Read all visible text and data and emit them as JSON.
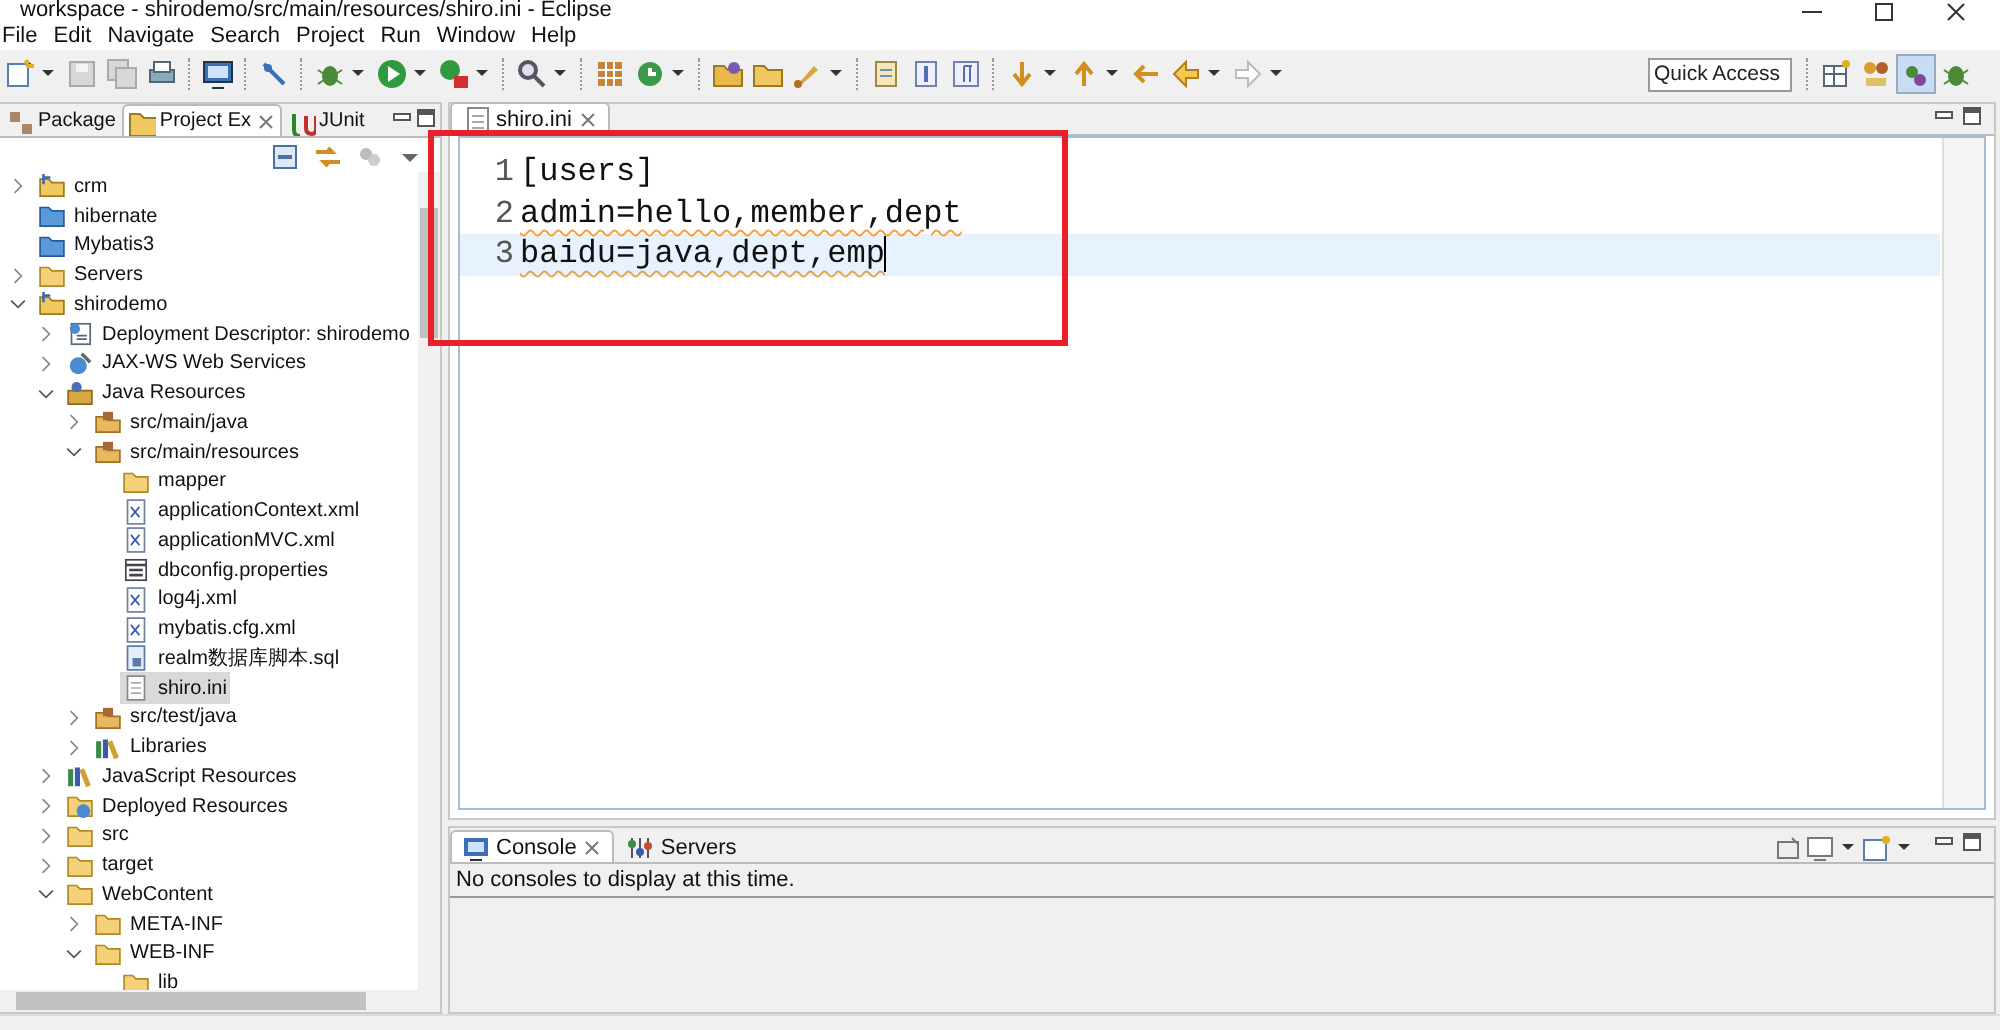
{
  "window": {
    "title": "workspace - shirodemo/src/main/resources/shiro.ini - Eclipse"
  },
  "menu": [
    "File",
    "Edit",
    "Navigate",
    "Search",
    "Project",
    "Run",
    "Window",
    "Help"
  ],
  "quick_access": {
    "placeholder": "Quick Access"
  },
  "left_tabs": [
    {
      "label": "Package",
      "selected": false,
      "closable": false
    },
    {
      "label": "Project Ex",
      "selected": true,
      "closable": true
    },
    {
      "label": "JUnit",
      "selected": false,
      "closable": false
    }
  ],
  "tree": [
    {
      "label": "crm",
      "kind": "project",
      "expanded": false,
      "selected": false
    },
    {
      "label": "hibernate",
      "kind": "closed-project",
      "selected": false
    },
    {
      "label": "Mybatis3",
      "kind": "closed-project",
      "selected": false
    },
    {
      "label": "Servers",
      "kind": "folder",
      "expanded": false,
      "selected": false
    },
    {
      "label": "shirodemo",
      "kind": "project",
      "expanded": true,
      "selected": false,
      "children": [
        {
          "label": "Deployment Descriptor: shirodemo",
          "kind": "descriptor",
          "expanded": false,
          "selected": false
        },
        {
          "label": "JAX-WS Web Services",
          "kind": "webservice",
          "expanded": false,
          "selected": false
        },
        {
          "label": "Java Resources",
          "kind": "java-resources",
          "expanded": true,
          "selected": false,
          "children": [
            {
              "label": "src/main/java",
              "kind": "source-folder",
              "expanded": false,
              "selected": false
            },
            {
              "label": "src/main/resources",
              "kind": "source-folder",
              "expanded": true,
              "selected": false,
              "children": [
                {
                  "label": "mapper",
                  "kind": "folder",
                  "selected": false
                },
                {
                  "label": "applicationContext.xml",
                  "kind": "xml",
                  "selected": false
                },
                {
                  "label": "applicationMVC.xml",
                  "kind": "xml",
                  "selected": false
                },
                {
                  "label": "dbconfig.properties",
                  "kind": "properties",
                  "selected": false
                },
                {
                  "label": "log4j.xml",
                  "kind": "xml",
                  "selected": false
                },
                {
                  "label": "mybatis.cfg.xml",
                  "kind": "xml",
                  "selected": false
                },
                {
                  "label": "realm数据库脚本.sql",
                  "kind": "sql",
                  "selected": false
                },
                {
                  "label": "shiro.ini",
                  "kind": "text",
                  "selected": true
                }
              ]
            },
            {
              "label": "src/test/java",
              "kind": "source-folder",
              "expanded": false,
              "selected": false
            },
            {
              "label": "Libraries",
              "kind": "library",
              "expanded": false,
              "selected": false
            }
          ]
        },
        {
          "label": "JavaScript Resources",
          "kind": "library",
          "expanded": false,
          "selected": false
        },
        {
          "label": "Deployed Resources",
          "kind": "deployed",
          "expanded": false,
          "selected": false
        },
        {
          "label": "src",
          "kind": "folder",
          "expanded": false,
          "selected": false
        },
        {
          "label": "target",
          "kind": "folder",
          "expanded": false,
          "selected": false
        },
        {
          "label": "WebContent",
          "kind": "folder",
          "expanded": true,
          "selected": false,
          "children": [
            {
              "label": "META-INF",
              "kind": "folder",
              "expanded": false,
              "selected": false
            },
            {
              "label": "WEB-INF",
              "kind": "folder",
              "expanded": true,
              "selected": false,
              "children": [
                {
                  "label": "lib",
                  "kind": "folder",
                  "selected": false
                }
              ]
            }
          ]
        }
      ]
    }
  ],
  "editor": {
    "tabs": [
      {
        "label": "shiro.ini",
        "selected": true
      }
    ],
    "lines": [
      {
        "number": "1",
        "text": "[users]",
        "current": false,
        "misspelled": false
      },
      {
        "number": "2",
        "text": "admin=hello,member,dept",
        "current": false,
        "misspelled": true
      },
      {
        "number": "3",
        "text": "baidu=java,dept,emp",
        "current": true,
        "misspelled": true
      }
    ]
  },
  "console": {
    "tabs": [
      {
        "label": "Console",
        "selected": true,
        "closable": true
      },
      {
        "label": "Servers",
        "selected": false,
        "closable": false
      }
    ],
    "message": "No consoles to display at this time."
  },
  "annotations": [
    {
      "kind": "rectangle"
    }
  ]
}
